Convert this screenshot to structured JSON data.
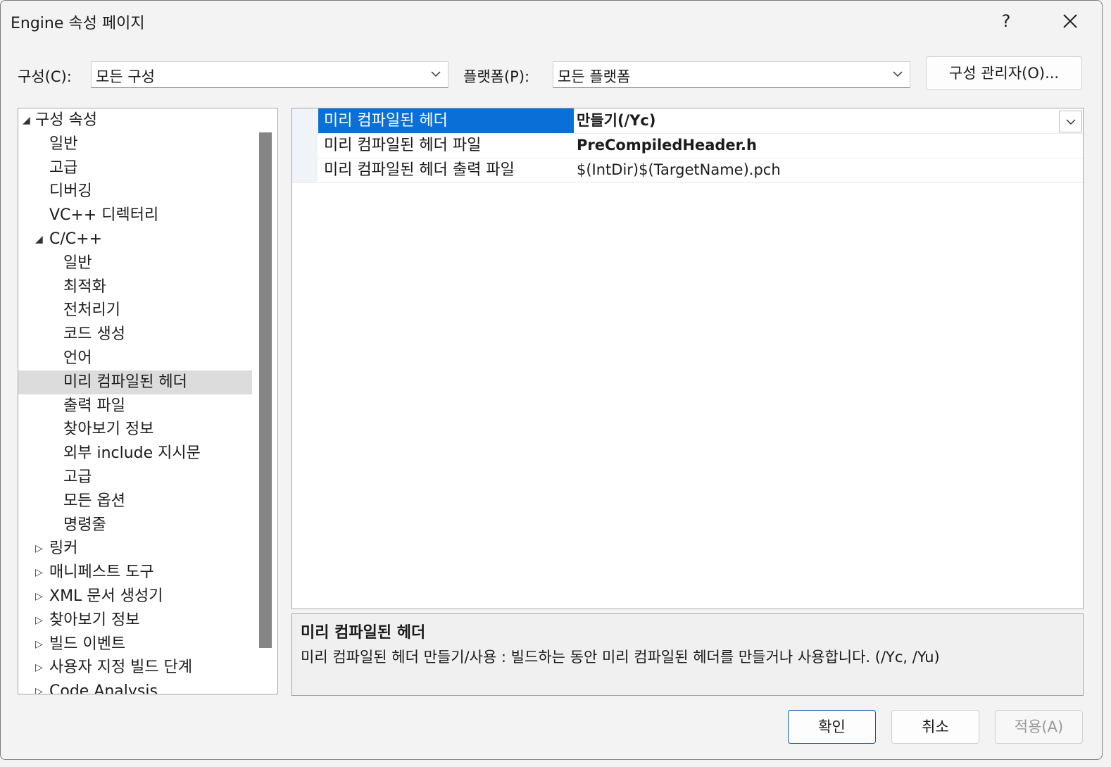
{
  "window": {
    "title": "Engine 속성 페이지",
    "help": "?",
    "close": "✕"
  },
  "toolbar": {
    "config_label": "구성(C):",
    "config_value": "모든 구성",
    "platform_label": "플랫폼(P):",
    "platform_value": "모든 플랫폼",
    "config_manager": "구성 관리자(O)..."
  },
  "tree": {
    "items": [
      {
        "label": "구성 속성",
        "expander": "◢"
      },
      {
        "label": "일반"
      },
      {
        "label": "고급"
      },
      {
        "label": "디버깅"
      },
      {
        "label": "VC++ 디렉터리"
      },
      {
        "label": "C/C++",
        "expander": "◢"
      },
      {
        "label": "일반"
      },
      {
        "label": "최적화"
      },
      {
        "label": "전처리기"
      },
      {
        "label": "코드 생성"
      },
      {
        "label": "언어"
      },
      {
        "label": "미리 컴파일된 헤더",
        "selected": true
      },
      {
        "label": "출력 파일"
      },
      {
        "label": "찾아보기 정보"
      },
      {
        "label": "외부 include 지시문"
      },
      {
        "label": "고급"
      },
      {
        "label": "모든 옵션"
      },
      {
        "label": "명령줄"
      },
      {
        "label": "링커",
        "expander": "▷"
      },
      {
        "label": "매니페스트 도구",
        "expander": "▷"
      },
      {
        "label": "XML 문서 생성기",
        "expander": "▷"
      },
      {
        "label": "찾아보기 정보",
        "expander": "▷"
      },
      {
        "label": "빌드 이벤트",
        "expander": "▷"
      },
      {
        "label": "사용자 지정 빌드 단계",
        "expander": "▷"
      },
      {
        "label": "Code Analysis",
        "expander": "▷"
      }
    ]
  },
  "grid": {
    "rows": [
      {
        "name": "미리 컴파일된 헤더",
        "value": "만들기(/Yc)"
      },
      {
        "name": "미리 컴파일된 헤더 파일",
        "value": "PreCompiledHeader.h"
      },
      {
        "name": "미리 컴파일된 헤더 출력 파일",
        "value": "$(IntDir)$(TargetName).pch"
      }
    ]
  },
  "description": {
    "title": "미리 컴파일된 헤더",
    "text": "미리 컴파일된 헤더 만들기/사용 : 빌드하는 동안 미리 컴파일된 헤더를 만들거나 사용합니다.      (/Yc, /Yu)"
  },
  "buttons": {
    "ok": "확인",
    "cancel": "취소",
    "apply": "적용(A)"
  }
}
